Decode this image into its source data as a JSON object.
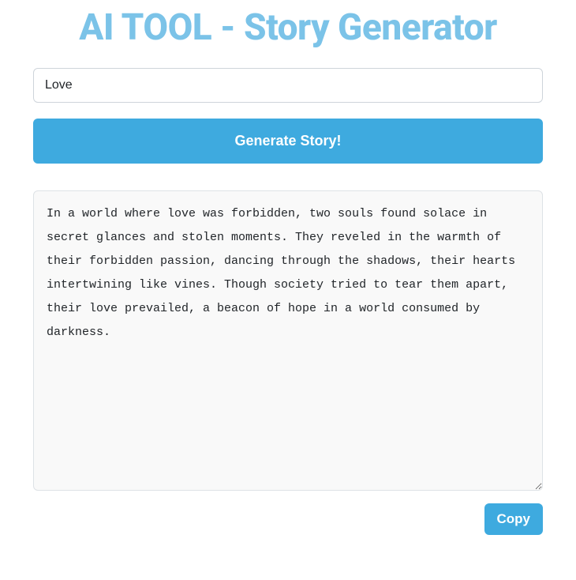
{
  "header": {
    "title": "AI TOOL - Story Generator"
  },
  "form": {
    "topic_value": "Love",
    "topic_placeholder": "",
    "generate_label": "Generate Story!"
  },
  "output": {
    "story_text": "In a world where love was forbidden, two souls found solace in secret glances and stolen moments. They reveled in the warmth of their forbidden passion, dancing through the shadows, their hearts intertwining like vines. Though society tried to tear them apart, their love prevailed, a beacon of hope in a world consumed by darkness.",
    "copy_label": "Copy"
  },
  "colors": {
    "accent": "#3eaadf",
    "title": "#7bc3e8",
    "border": "#ced4da",
    "output_bg": "#f9f9f9"
  }
}
